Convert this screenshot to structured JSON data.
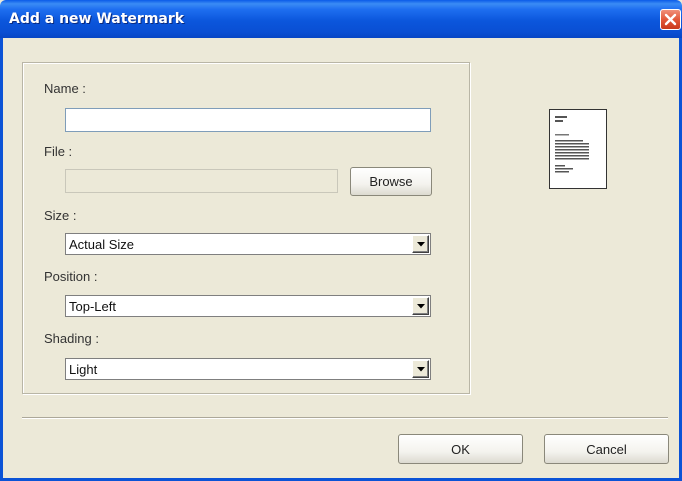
{
  "window": {
    "title": "Add a new Watermark"
  },
  "form": {
    "name_label": "Name :",
    "name_value": "",
    "file_label": "File :",
    "file_value": "",
    "browse_label": "Browse",
    "size_label": "Size :",
    "size_value": "Actual Size",
    "position_label": "Position :",
    "position_value": "Top-Left",
    "shading_label": "Shading :",
    "shading_value": "Light"
  },
  "preview": {
    "icon": "document-preview-icon"
  },
  "footer": {
    "ok_label": "OK",
    "cancel_label": "Cancel"
  },
  "colors": {
    "titlebar": "#0a4fd3",
    "dialog_bg": "#ece9d8",
    "close_button": "#e2583a"
  }
}
